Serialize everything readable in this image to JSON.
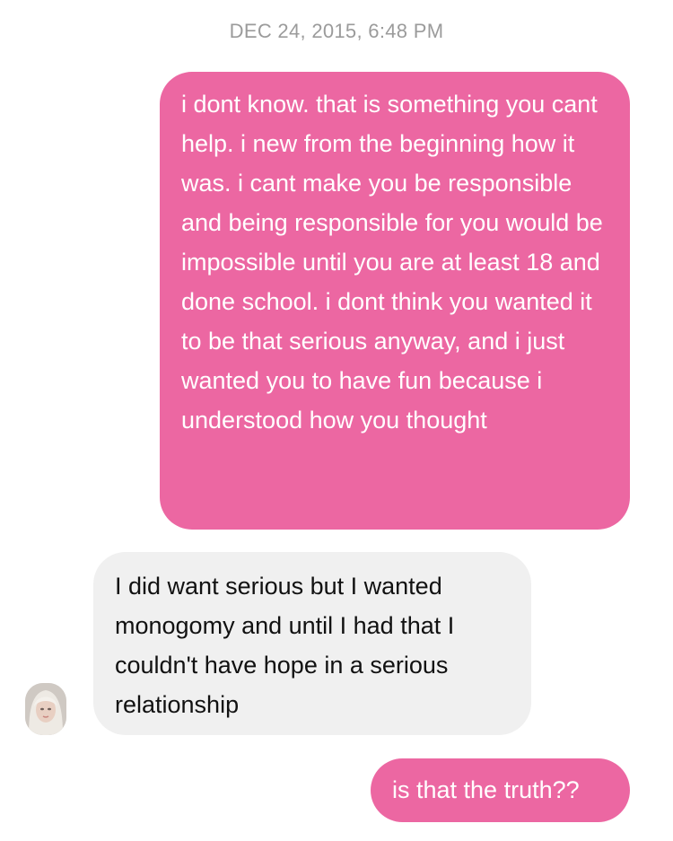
{
  "conversation": {
    "timestamp": "DEC 24, 2015, 6:48 PM",
    "messages": [
      {
        "direction": "sent",
        "text": "i dont know. that is something you cant help. i new from the beginning how it was. i cant make you be responsible and being responsible for you would be impossible until you are at least 18 and done school. i dont think you wanted it to be that serious anyway, and i just wanted you to have fun because i understood how you thought"
      },
      {
        "direction": "received",
        "text": "I did want serious but I wanted monogomy and until I had that I couldn't have hope in a serious relationship"
      },
      {
        "direction": "sent",
        "text": "is that the truth??"
      }
    ]
  },
  "colors": {
    "sent_bubble": "#ec67a2",
    "received_bubble": "#f0f0f0",
    "timestamp_text": "#9b9b9b"
  }
}
